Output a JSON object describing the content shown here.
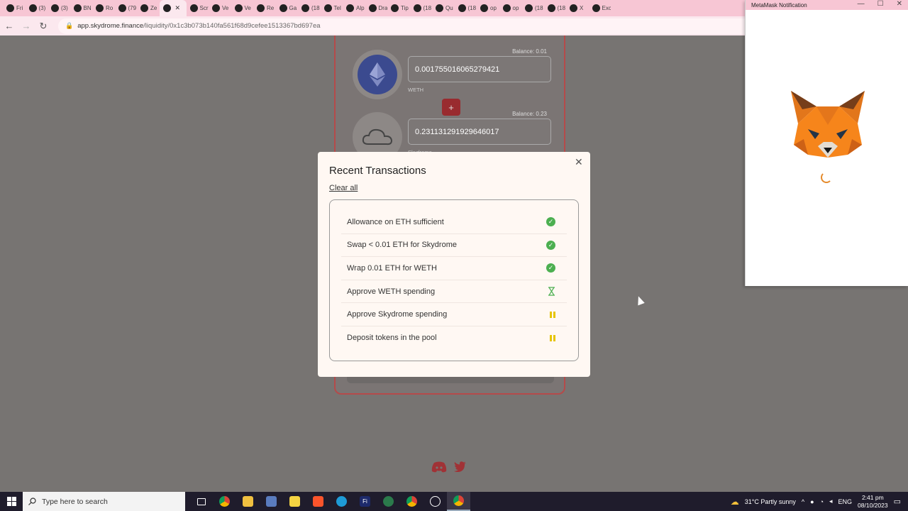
{
  "browser": {
    "tabs": [
      {
        "label": "Fri",
        "active": false
      },
      {
        "label": "(3)",
        "active": false
      },
      {
        "label": "(3)",
        "active": false
      },
      {
        "label": "BN",
        "active": false
      },
      {
        "label": "Ro",
        "active": false
      },
      {
        "label": "(79",
        "active": false
      },
      {
        "label": "Ze",
        "active": false
      },
      {
        "label": "",
        "active": true
      },
      {
        "label": "Scr",
        "active": false
      },
      {
        "label": "Ve",
        "active": false
      },
      {
        "label": "Ve",
        "active": false
      },
      {
        "label": "Re",
        "active": false
      },
      {
        "label": "Ga",
        "active": false
      },
      {
        "label": "(18",
        "active": false
      },
      {
        "label": "Tel",
        "active": false
      },
      {
        "label": "Alp",
        "active": false
      },
      {
        "label": "Dra",
        "active": false
      },
      {
        "label": "Tip",
        "active": false
      },
      {
        "label": "(18",
        "active": false
      },
      {
        "label": "Qu",
        "active": false
      },
      {
        "label": "(18",
        "active": false
      },
      {
        "label": "op",
        "active": false
      },
      {
        "label": "op",
        "active": false
      },
      {
        "label": "(18",
        "active": false
      },
      {
        "label": "(18",
        "active": false
      },
      {
        "label": "X",
        "active": false
      },
      {
        "label": "Exc",
        "active": false
      }
    ],
    "url_host": "app.skydrome.finance",
    "url_path": "/liquidity/0x1c3b073b140fa561f68d9cefee1513367bd697ea"
  },
  "pool": {
    "token1": {
      "balance": "Balance: 0.01",
      "amount": "0.001755016065279421",
      "label": "WETH"
    },
    "token2": {
      "balance": "Balance: 0.23",
      "amount": "0.231131291929646017",
      "label": "Skydrome"
    },
    "plus": "+"
  },
  "modal": {
    "title": "Recent Transactions",
    "clear_all": "Clear all",
    "close": "✕",
    "transactions": [
      {
        "label": "Allowance on ETH sufficient",
        "status": "done"
      },
      {
        "label": "Swap < 0.01 ETH for Skydrome",
        "status": "done"
      },
      {
        "label": "Wrap 0.01 ETH for WETH",
        "status": "done"
      },
      {
        "label": "Approve WETH spending",
        "status": "pending"
      },
      {
        "label": "Approve Skydrome spending",
        "status": "paused"
      },
      {
        "label": "Deposit tokens in the pool",
        "status": "paused"
      }
    ]
  },
  "metamask": {
    "title": "MetaMask Notification",
    "min": "—",
    "max": "☐",
    "close": "✕"
  },
  "taskbar": {
    "search_placeholder": "Type here to search",
    "weather": "31°C  Partly sunny",
    "lang": "ENG",
    "time": "2:41 pm",
    "date": "08/10/2023"
  },
  "colors": {
    "accent_red": "#992b2f",
    "success_green": "#4caf50",
    "pending_yellow": "#e6c400",
    "modal_bg": "#fff8f3"
  }
}
